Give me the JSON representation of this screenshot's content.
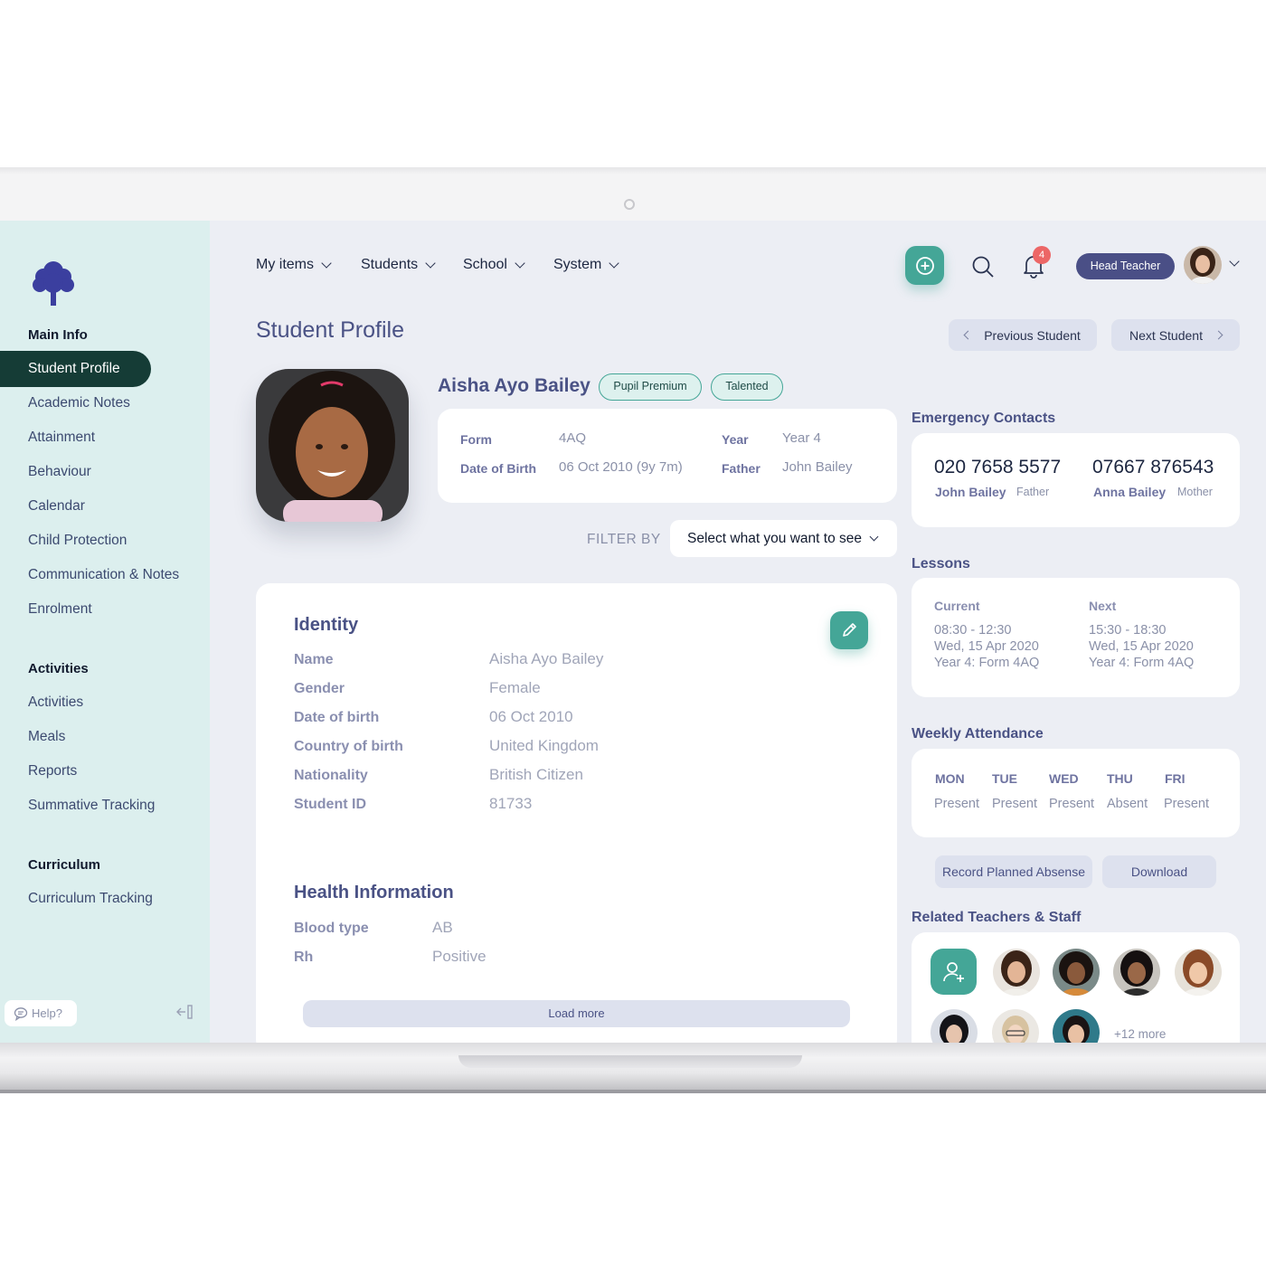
{
  "nav": {
    "my_items": "My items",
    "students": "Students",
    "school": "School",
    "system": "System",
    "notification_count": "4",
    "role": "Head Teacher"
  },
  "sidebar": {
    "main_info": "Main Info",
    "main_items": [
      {
        "label": "Student Profile",
        "active": true
      },
      {
        "label": "Academic Notes"
      },
      {
        "label": "Attainment"
      },
      {
        "label": "Behaviour"
      },
      {
        "label": "Calendar"
      },
      {
        "label": "Child Protection"
      },
      {
        "label": "Communication & Notes"
      },
      {
        "label": "Enrolment"
      }
    ],
    "activities_heading": "Activities",
    "activities_items": [
      {
        "label": "Activities"
      },
      {
        "label": "Meals"
      },
      {
        "label": "Reports"
      },
      {
        "label": "Summative Tracking"
      }
    ],
    "curriculum_heading": "Curriculum",
    "curriculum_items": [
      {
        "label": "Curriculum Tracking"
      }
    ],
    "help": "Help?"
  },
  "header": {
    "title": "Student Profile",
    "previous": "Previous Student",
    "next": "Next Student"
  },
  "student": {
    "name": "Aisha Ayo Bailey",
    "tags": [
      "Pupil Premium",
      "Talented"
    ],
    "summary": {
      "form_label": "Form",
      "form": "4AQ",
      "dob_label": "Date of Birth",
      "dob": "06 Oct 2010 (9y 7m)",
      "year_label": "Year",
      "year": "Year 4",
      "father_label": "Father",
      "father": "John Bailey"
    }
  },
  "filter": {
    "label": "FILTER BY",
    "value": "Select what you want to see"
  },
  "identity": {
    "title": "Identity",
    "rows": [
      {
        "label": "Name",
        "value": "Aisha Ayo Bailey"
      },
      {
        "label": "Gender",
        "value": "Female"
      },
      {
        "label": "Date of birth",
        "value": "06 Oct 2010"
      },
      {
        "label": "Country of birth",
        "value": "United Kingdom"
      },
      {
        "label": "Nationality",
        "value": "British Citizen"
      },
      {
        "label": "Student ID",
        "value": "81733"
      }
    ]
  },
  "health": {
    "title": "Health Information",
    "rows": [
      {
        "label": "Blood type",
        "value": "AB"
      },
      {
        "label": "Rh",
        "value": "Positive"
      }
    ],
    "load_more": "Load more"
  },
  "emergency": {
    "title": "Emergency Contacts",
    "contacts": [
      {
        "phone": "020 7658 5577",
        "name": "John Bailey",
        "relation": "Father"
      },
      {
        "phone": "07667 876543",
        "name": "Anna Bailey",
        "relation": "Mother"
      }
    ]
  },
  "lessons": {
    "title": "Lessons",
    "current": {
      "label": "Current",
      "time": "08:30 - 12:30",
      "date": "Wed, 15 Apr 2020",
      "group": "Year 4: Form 4AQ"
    },
    "next": {
      "label": "Next",
      "time": "15:30 - 18:30",
      "date": "Wed, 15 Apr 2020",
      "group": "Year 4: Form 4AQ"
    }
  },
  "attendance": {
    "title": "Weekly Attendance",
    "days": [
      {
        "day": "MON",
        "status": "Present"
      },
      {
        "day": "TUE",
        "status": "Present"
      },
      {
        "day": "WED",
        "status": "Present"
      },
      {
        "day": "THU",
        "status": "Absent"
      },
      {
        "day": "FRI",
        "status": "Present"
      }
    ],
    "record_button": "Record Planned Absense",
    "download_button": "Download"
  },
  "staff": {
    "title": "Related Teachers & Staff",
    "more": "+12 more"
  },
  "colors": {
    "accent": "#44a697",
    "sidebar_bg": "#dcefee",
    "sidebar_active": "#153c36",
    "heading": "#4a5285",
    "role_pill": "#4a4f86",
    "badge": "#ec6666"
  }
}
